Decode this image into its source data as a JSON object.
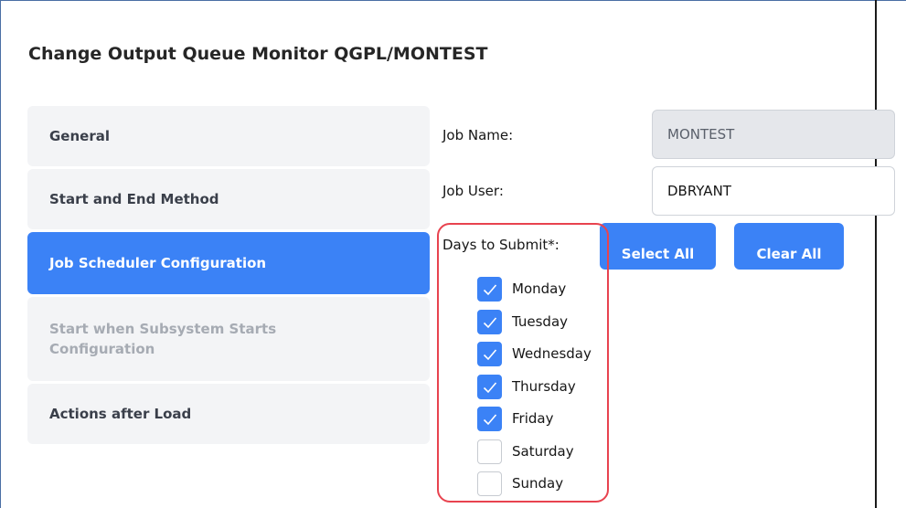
{
  "dialog": {
    "title": "Change Output Queue Monitor QGPL/MONTEST"
  },
  "nav": {
    "items": [
      {
        "label": "General"
      },
      {
        "label": "Start and End Method"
      },
      {
        "label": "Job Scheduler Configuration",
        "active": true
      },
      {
        "label": "Start when Subsystem Starts Configuration",
        "disabled": true
      },
      {
        "label": "Actions after Load"
      }
    ]
  },
  "form": {
    "job_name": {
      "label": "Job Name:",
      "value": "MONTEST",
      "readonly": true
    },
    "job_user": {
      "label": "Job User:",
      "value": "DBRYANT"
    },
    "days": {
      "label": "Days to Submit*:",
      "select_all_label": "Select All",
      "clear_all_label": "Clear All",
      "items": [
        {
          "label": "Monday",
          "checked": true
        },
        {
          "label": "Tuesday",
          "checked": true
        },
        {
          "label": "Wednesday",
          "checked": true
        },
        {
          "label": "Thursday",
          "checked": true
        },
        {
          "label": "Friday",
          "checked": true
        },
        {
          "label": "Saturday",
          "checked": false
        },
        {
          "label": "Sunday",
          "checked": false
        }
      ]
    }
  },
  "colors": {
    "accent": "#3b82f6",
    "highlight": "#e8434f",
    "nav_background": "#f3f4f6",
    "readonly_background": "#e5e7eb"
  }
}
